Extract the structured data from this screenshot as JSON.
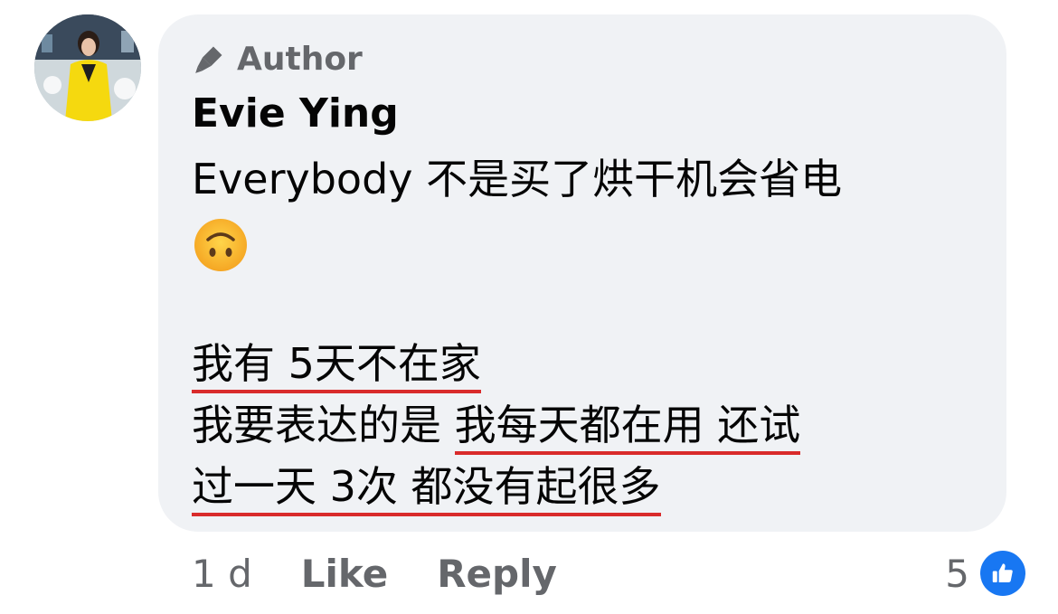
{
  "comment": {
    "author_badge": "Author",
    "author_name": "Evie Ying",
    "lines": [
      "Everybody 不是买了烘干机会省电",
      "",
      "我有 5天不在家",
      "我要表达的是",
      "我每天都在用 还试",
      "过一天 3次 都没有起很多"
    ],
    "emoji": "upside-down-face"
  },
  "footer": {
    "time": "1 d",
    "like_label": "Like",
    "reply_label": "Reply",
    "reaction_count": "5"
  },
  "colors": {
    "bubble_bg": "#f0f2f5",
    "secondary_text": "#65676b",
    "like_blue": "#1877f2",
    "underline_red": "#d92b2b"
  }
}
